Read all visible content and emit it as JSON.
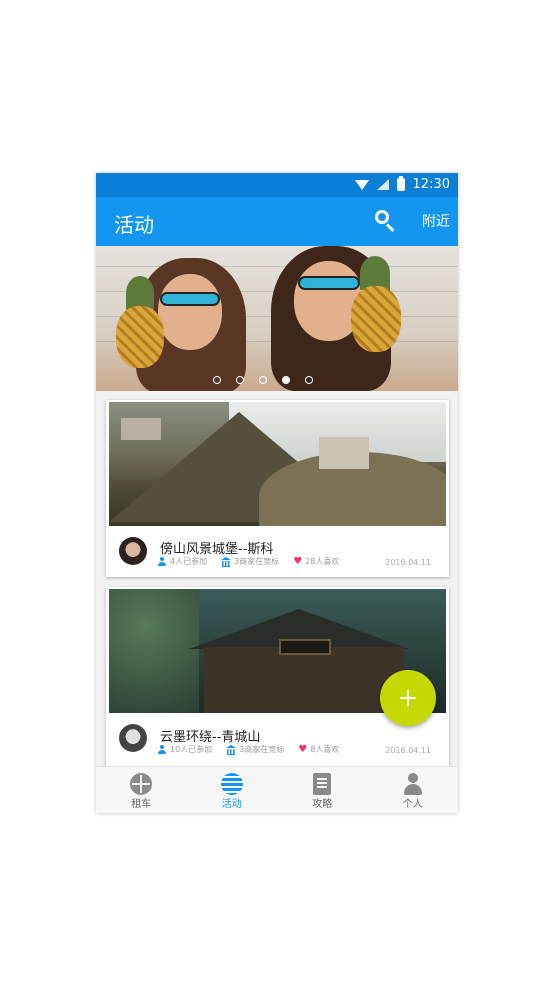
{
  "status_bar": {
    "time": "12:30"
  },
  "app_bar": {
    "title": "活动",
    "search_icon": "search-icon",
    "nearby_label": "附近"
  },
  "banner": {
    "slide_count": 5,
    "active_slide": 4
  },
  "cards": [
    {
      "title": "傍山风景城堡--斯科",
      "participants": "4人已参加",
      "merchants": "3商家在竞标",
      "likes": "28人喜欢",
      "date": "2016.04.11"
    },
    {
      "title": "云墨环绕--青城山",
      "participants": "10人已参加",
      "merchants": "3商家在竞标",
      "likes": "8人喜欢",
      "date": "2016.04.11"
    }
  ],
  "fab": {
    "icon": "plus-icon"
  },
  "tabs": [
    {
      "label": "租车",
      "icon": "car-icon",
      "active": false
    },
    {
      "label": "活动",
      "icon": "activity-icon",
      "active": true
    },
    {
      "label": "攻略",
      "icon": "guide-icon",
      "active": false
    },
    {
      "label": "个人",
      "icon": "person-icon",
      "active": false
    }
  ],
  "colors": {
    "primary": "#1296f0",
    "status_bar": "#0a7fd8",
    "fab": "#c3d900",
    "like": "#f0356a"
  }
}
